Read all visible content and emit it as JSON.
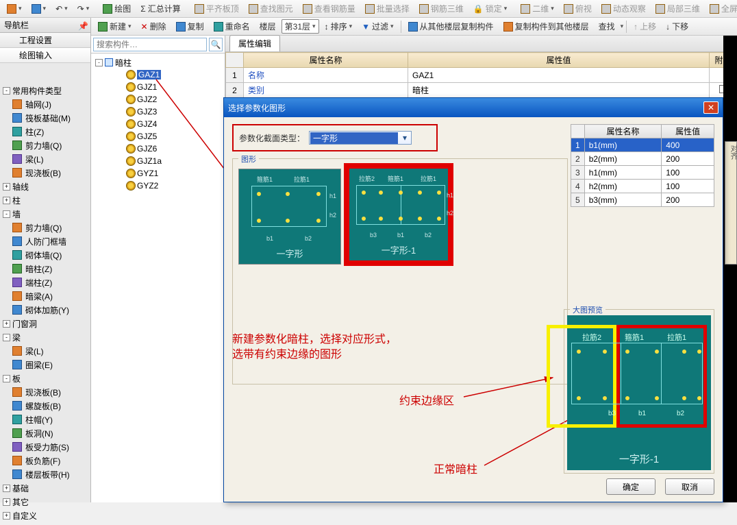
{
  "toolbar1": {
    "draw": "绘图",
    "sumcalc": "汇总计算",
    "flat_top": "平齐板顶",
    "find_view": "查找图元",
    "view_rebar": "查看钢筋量",
    "batch_sel": "批量选择",
    "rebar_3d": "钢筋三维",
    "lock": "锁定",
    "two_d": "二维",
    "iso": "俯视",
    "dyn": "动态观察",
    "local_3d": "局部三维",
    "full": "全屏"
  },
  "toolbar2": {
    "new": "新建",
    "delete": "删除",
    "copy": "复制",
    "rename": "重命名",
    "floor": "楼层",
    "floor_val": "第31层",
    "sort": "排序",
    "filter": "过滤",
    "copy_from": "从其他楼层复制构件",
    "copy_to": "复制构件到其他楼层",
    "find": "查找",
    "up": "上移",
    "down": "下移"
  },
  "nav": {
    "title": "导航栏",
    "item1": "工程设置",
    "item2": "绘图输入"
  },
  "left_tree": {
    "groups": [
      "常用构件类型",
      "轴线",
      "柱",
      "墙",
      "门窗洞",
      "梁",
      "板",
      "基础",
      "其它",
      "自定义"
    ],
    "g0": [
      "轴网(J)",
      "筏板基础(M)",
      "柱(Z)",
      "剪力墙(Q)",
      "梁(L)",
      "现浇板(B)"
    ],
    "g2": [
      "剪力墙(Q)",
      "人防门框墙",
      "砌体墙(Q)",
      "暗柱(Z)",
      "端柱(Z)",
      "暗梁(A)",
      "砌体加筋(Y)"
    ],
    "g4": [
      "梁(L)",
      "圈梁(E)"
    ],
    "g5": [
      "现浇板(B)",
      "螺旋板(B)",
      "柱帽(Y)",
      "板洞(N)",
      "板受力筋(S)",
      "板负筋(F)",
      "楼层板带(H)"
    ]
  },
  "search": {
    "placeholder": "搜索构件…"
  },
  "comp_tree": {
    "root": "暗柱",
    "items": [
      "GAZ1",
      "GJZ1",
      "GJZ2",
      "GJZ3",
      "GJZ4",
      "GJZ5",
      "GJZ6",
      "GJZ1a",
      "GYZ1",
      "GYZ2"
    ],
    "selected": 0
  },
  "prop_tab": "属性编辑",
  "prop_cols": {
    "name": "属性名称",
    "value": "属性值",
    "extra": "附加"
  },
  "prop_rows": [
    {
      "n": "1",
      "name": "名称",
      "value": "GAZ1",
      "chk": false
    },
    {
      "n": "2",
      "name": "类别",
      "value": "暗柱",
      "chk": true
    }
  ],
  "modal": {
    "title": "选择参数化图形",
    "param_label": "参数化截面类型：",
    "param_value": "一字形",
    "figset_label": "图形",
    "thumb1_label": "一字形",
    "thumb2_label": "一字形-1",
    "rebar_labels": {
      "gj1": "箍筋1",
      "lj1": "拉筋1",
      "lj2": "拉筋2"
    },
    "anno1a": "新建参数化暗柱，选择对应形式，",
    "anno1b": "选带有约束边缘的图形",
    "anno2": "约束边缘区",
    "anno3": "正常暗柱",
    "grid_cols": {
      "name": "属性名称",
      "value": "属性值"
    },
    "grid_rows": [
      {
        "n": "1",
        "name": "b1(mm)",
        "value": "400"
      },
      {
        "n": "2",
        "name": "b2(mm)",
        "value": "200"
      },
      {
        "n": "3",
        "name": "h1(mm)",
        "value": "100"
      },
      {
        "n": "4",
        "name": "h2(mm)",
        "value": "100"
      },
      {
        "n": "5",
        "name": "b3(mm)",
        "value": "200"
      }
    ],
    "preview_label": "大图预览",
    "preview_caption": "一字形-1",
    "ok": "确定",
    "cancel": "取消"
  }
}
